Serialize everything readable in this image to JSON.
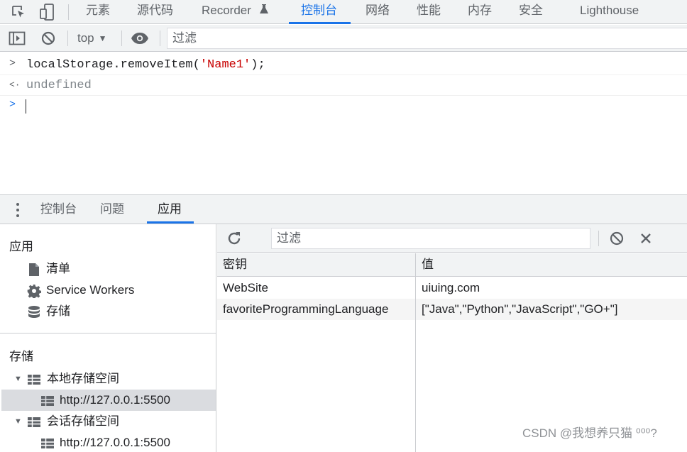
{
  "tabs": [
    {
      "label": "元素"
    },
    {
      "label": "源代码"
    },
    {
      "label": "Recorder"
    },
    {
      "label": "控制台"
    },
    {
      "label": "网络"
    },
    {
      "label": "性能"
    },
    {
      "label": "内存"
    },
    {
      "label": "安全"
    },
    {
      "label": "Lighthouse"
    }
  ],
  "active_tab": "控制台",
  "toolbar": {
    "context": "top",
    "filter_placeholder": "过滤"
  },
  "console": {
    "lines": [
      {
        "prefix": "localStorage.removeItem(",
        "string": "'Name1'",
        "suffix": ");"
      },
      {
        "result": "undefined"
      }
    ]
  },
  "drawer": {
    "tabs": [
      {
        "label": "控制台"
      },
      {
        "label": "问题"
      },
      {
        "label": "应用"
      }
    ],
    "active": "应用"
  },
  "sidebar": {
    "app_heading": "应用",
    "app_items": [
      {
        "label": "清单",
        "icon": "document-icon"
      },
      {
        "label": "Service Workers",
        "icon": "gear-icon"
      },
      {
        "label": "存储",
        "icon": "database-icon"
      }
    ],
    "storage_heading": "存储",
    "local_storage": {
      "label": "本地存储空间",
      "origin": "http://127.0.0.1:5500"
    },
    "session_storage": {
      "label": "会话存储空间",
      "origin": "http://127.0.0.1:5500"
    }
  },
  "storage_view": {
    "filter_placeholder": "过滤",
    "columns": {
      "key": "密钥",
      "value": "值"
    },
    "rows": [
      {
        "key": "WebSite",
        "value": "uiuing.com"
      },
      {
        "key": "favoriteProgrammingLanguage",
        "value": "[\"Java\",\"Python\",\"JavaScript\",\"GO+\"]"
      }
    ]
  },
  "watermark": "CSDN @我想养只猫 ⁰⁰⁰?",
  "colors": {
    "accent": "#1a73e8",
    "string": "#c80000",
    "selection": "#dadce0"
  }
}
